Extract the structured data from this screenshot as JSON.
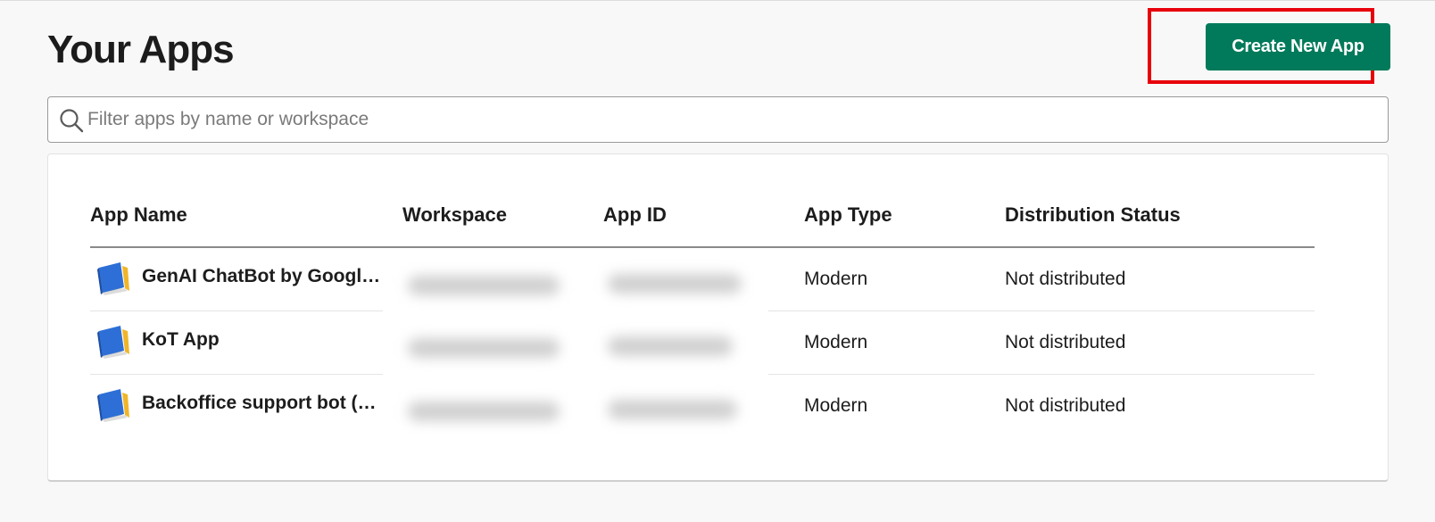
{
  "header": {
    "title": "Your Apps",
    "create_button_label": "Create New App"
  },
  "filter": {
    "placeholder": "Filter apps by name or workspace",
    "value": ""
  },
  "table": {
    "columns": [
      "App Name",
      "Workspace",
      "App ID",
      "App Type",
      "Distribution Status"
    ],
    "rows": [
      {
        "name": "GenAI ChatBot by Google …",
        "workspace": "",
        "app_id": "",
        "app_type": "Modern",
        "distribution_status": "Not distributed",
        "icon": "app-book-icon"
      },
      {
        "name": "KoT App",
        "workspace": "",
        "app_id": "",
        "app_type": "Modern",
        "distribution_status": "Not distributed",
        "icon": "app-book-icon"
      },
      {
        "name": "Backoffice support bot (dev)",
        "workspace": "",
        "app_id": "",
        "app_type": "Modern",
        "distribution_status": "Not distributed",
        "icon": "app-book-icon"
      }
    ]
  },
  "colors": {
    "primary_button": "#007a5a",
    "highlight_border": "#e8000b",
    "page_background": "#f8f8f8"
  }
}
